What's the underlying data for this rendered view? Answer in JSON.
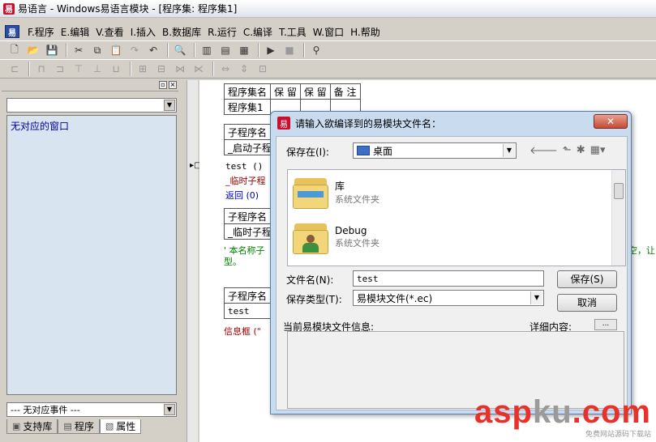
{
  "title_bar": {
    "title": "易语言 - Windows易语言模块 - [程序集: 程序集1]"
  },
  "menu": {
    "items": [
      "F.程序",
      "E.编辑",
      "V.查看",
      "I.插入",
      "B.数据库",
      "R.运行",
      "C.编译",
      "T.工具",
      "W.窗口",
      "H.帮助"
    ]
  },
  "left_panel": {
    "top_combo_value": "",
    "window_list_entry": "无对应的窗口",
    "event_combo_value": "--- 无对应事件 ---",
    "tabs": [
      "支持库",
      "程序",
      "属性"
    ]
  },
  "editor": {
    "assembly_table": {
      "headers": [
        "程序集名",
        "保 留",
        "保 留",
        "备 注"
      ],
      "row": [
        "程序集1",
        "",
        "",
        ""
      ]
    },
    "sub1_header": "子程序名",
    "sub1_name": "_启动子程",
    "line_test": "test ()",
    "line_temp": "_临时子程",
    "line_return": "返回 (0)",
    "sub2_header": "子程序名",
    "sub2_name": "_临时子程",
    "comment_line1": "' 本名称子",
    "comment_tail1": "空，让",
    "comment_line2": "型。",
    "sub3_header": "子程序名",
    "sub3_name": "test",
    "line_msgbox": "信息框 (\""
  },
  "dialog": {
    "title": "请输入欲编译到的易模块文件名：",
    "close_label": "✕",
    "save_in_label": "保存在(I):",
    "save_in_value": "桌面",
    "files": [
      {
        "name": "库",
        "type": "系统文件夹"
      },
      {
        "name": "Debug",
        "type": "系统文件夹"
      }
    ],
    "filename_label": "文件名(N):",
    "filename_value": "test",
    "filetype_label": "保存类型(T):",
    "filetype_value": "易模块文件(*.ec)",
    "save_button": "保存(S)",
    "cancel_button": "取消",
    "module_info_label": "当前易模块文件信息:",
    "details_label": "详细内容:",
    "details_button": "..."
  },
  "watermark": {
    "text_red1": "asp",
    "text_gray": "ku",
    "text_red2": ".com",
    "sub": "免费网站源码下载站"
  }
}
